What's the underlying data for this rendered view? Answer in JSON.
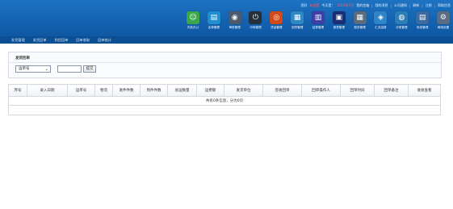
{
  "header": {
    "top_links": {
      "greeting": "您好",
      "user": "欢迎您",
      "date_prefix": "今天是：",
      "date_value": "2016年1月",
      "links": [
        "我的信箱",
        "我的消息",
        "公司通知",
        "刷新",
        "注销",
        "帮助信息"
      ]
    },
    "modules": [
      {
        "label": "内务办公",
        "icon": "person-icon",
        "color": "#3aa84a",
        "glyph": "☺"
      },
      {
        "label": "名单管理",
        "icon": "card-icon",
        "color": "#1f8fd0",
        "glyph": "▤"
      },
      {
        "label": "审核管理",
        "icon": "badge-icon",
        "color": "#4c5a6e",
        "glyph": "◉"
      },
      {
        "label": "中转管理",
        "icon": "power-icon",
        "color": "#26303d",
        "glyph": "⏻"
      },
      {
        "label": "货运管理",
        "icon": "target-icon",
        "color": "#d24a1a",
        "glyph": "◎"
      },
      {
        "label": "到货管理",
        "icon": "document-icon",
        "color": "#2c89c6",
        "glyph": "▦"
      },
      {
        "label": "结算管理",
        "icon": "book-icon",
        "color": "#3d3fa6",
        "glyph": "▥"
      },
      {
        "label": "报表管理",
        "icon": "chart-icon",
        "color": "#1a2f73",
        "glyph": "▣"
      },
      {
        "label": "账务管理",
        "icon": "calculator-icon",
        "color": "#5c6b7e",
        "glyph": "▦"
      },
      {
        "label": "汇总结算",
        "icon": "pin-icon",
        "color": "#2e86c8",
        "glyph": "◈"
      },
      {
        "label": "分类管理",
        "icon": "globe-icon",
        "color": "#2b7fb8",
        "glyph": "◍"
      },
      {
        "label": "系统管理",
        "icon": "clipboard-icon",
        "color": "#3b6aa1",
        "glyph": "▤"
      },
      {
        "label": "网络设置",
        "icon": "settings-icon",
        "color": "#5a6d84",
        "glyph": "⚙"
      }
    ],
    "subnav": [
      "发货管理",
      "发货回单",
      "到货回单",
      "回单收取",
      "回单统计"
    ]
  },
  "panel": {
    "title": "发货回单",
    "select_value": "运单号",
    "input_value": "",
    "query_label": "提交"
  },
  "table": {
    "columns": [
      "序号",
      "录入日期",
      "运单号",
      "物流",
      "发件件数",
      "到件件数",
      "总运数量",
      "运费额",
      "发货单位",
      "签收回单",
      "回单操作人",
      "回单时间",
      "回单备注",
      "收发查看"
    ],
    "empty_text": "共有0条信息，分为0页"
  }
}
